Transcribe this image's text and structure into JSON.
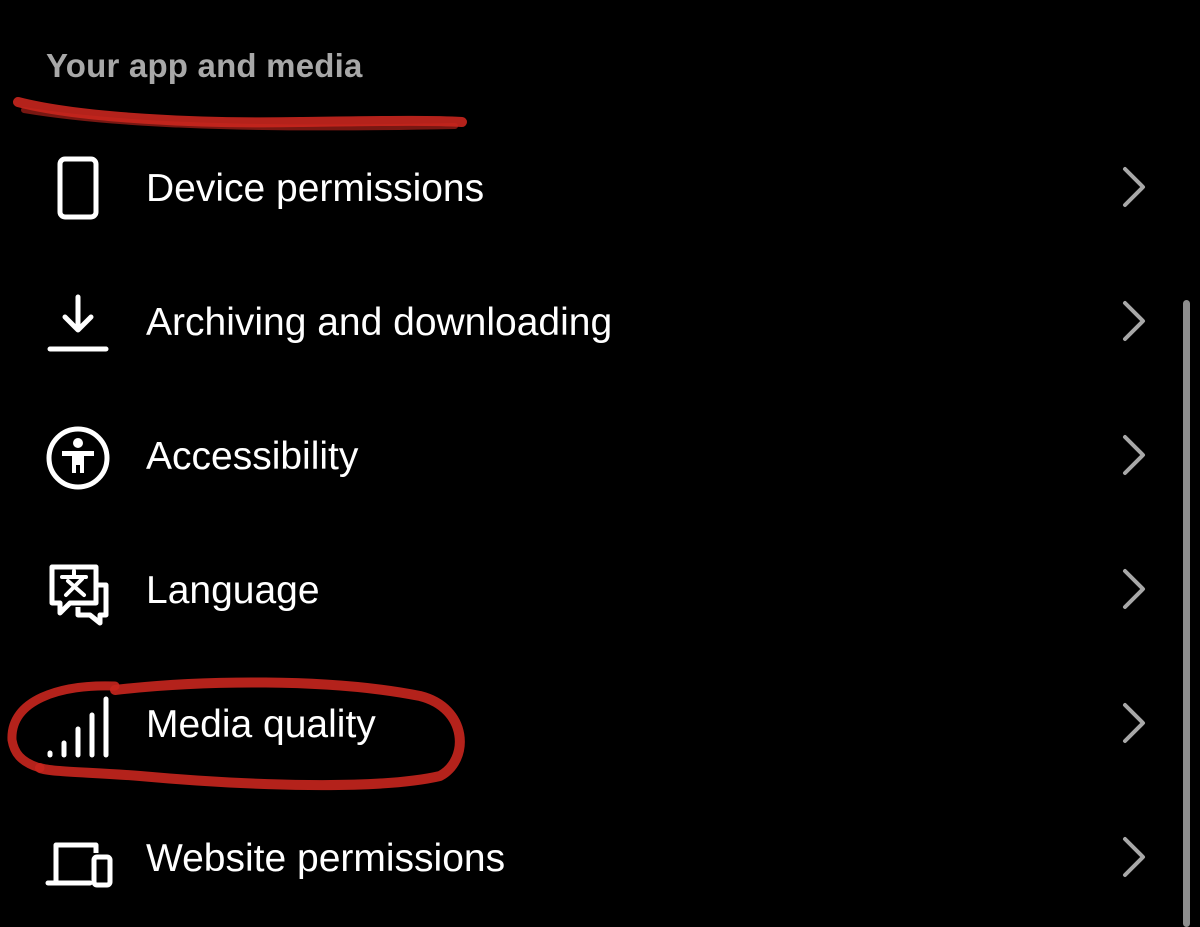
{
  "section": {
    "title": "Your app and media"
  },
  "menu": {
    "items": [
      {
        "label": "Device permissions",
        "icon": "phone-icon"
      },
      {
        "label": "Archiving and downloading",
        "icon": "download-icon"
      },
      {
        "label": "Accessibility",
        "icon": "accessibility-icon"
      },
      {
        "label": "Language",
        "icon": "translate-icon"
      },
      {
        "label": "Media quality",
        "icon": "signal-bars-icon"
      },
      {
        "label": "Website permissions",
        "icon": "laptop-phone-icon"
      }
    ]
  },
  "colors": {
    "background": "#000000",
    "text": "#ffffff",
    "section_title": "#a8a8a8",
    "chevron": "#a8a8a8",
    "annotation": "#c8261e",
    "scrollbar": "#8e8e8e"
  }
}
